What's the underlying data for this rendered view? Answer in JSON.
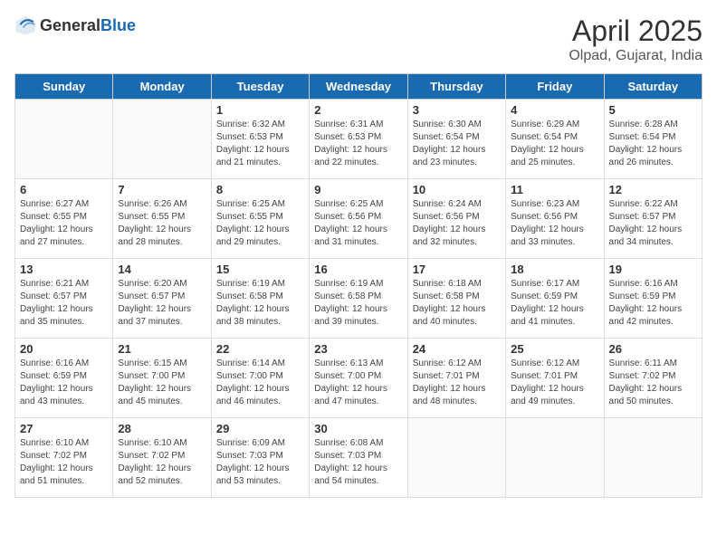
{
  "header": {
    "logo_general": "General",
    "logo_blue": "Blue",
    "month_title": "April 2025",
    "location": "Olpad, Gujarat, India"
  },
  "days_of_week": [
    "Sunday",
    "Monday",
    "Tuesday",
    "Wednesday",
    "Thursday",
    "Friday",
    "Saturday"
  ],
  "weeks": [
    [
      {
        "day": "",
        "info": ""
      },
      {
        "day": "",
        "info": ""
      },
      {
        "day": "1",
        "info": "Sunrise: 6:32 AM\nSunset: 6:53 PM\nDaylight: 12 hours and 21 minutes."
      },
      {
        "day": "2",
        "info": "Sunrise: 6:31 AM\nSunset: 6:53 PM\nDaylight: 12 hours and 22 minutes."
      },
      {
        "day": "3",
        "info": "Sunrise: 6:30 AM\nSunset: 6:54 PM\nDaylight: 12 hours and 23 minutes."
      },
      {
        "day": "4",
        "info": "Sunrise: 6:29 AM\nSunset: 6:54 PM\nDaylight: 12 hours and 25 minutes."
      },
      {
        "day": "5",
        "info": "Sunrise: 6:28 AM\nSunset: 6:54 PM\nDaylight: 12 hours and 26 minutes."
      }
    ],
    [
      {
        "day": "6",
        "info": "Sunrise: 6:27 AM\nSunset: 6:55 PM\nDaylight: 12 hours and 27 minutes."
      },
      {
        "day": "7",
        "info": "Sunrise: 6:26 AM\nSunset: 6:55 PM\nDaylight: 12 hours and 28 minutes."
      },
      {
        "day": "8",
        "info": "Sunrise: 6:25 AM\nSunset: 6:55 PM\nDaylight: 12 hours and 29 minutes."
      },
      {
        "day": "9",
        "info": "Sunrise: 6:25 AM\nSunset: 6:56 PM\nDaylight: 12 hours and 31 minutes."
      },
      {
        "day": "10",
        "info": "Sunrise: 6:24 AM\nSunset: 6:56 PM\nDaylight: 12 hours and 32 minutes."
      },
      {
        "day": "11",
        "info": "Sunrise: 6:23 AM\nSunset: 6:56 PM\nDaylight: 12 hours and 33 minutes."
      },
      {
        "day": "12",
        "info": "Sunrise: 6:22 AM\nSunset: 6:57 PM\nDaylight: 12 hours and 34 minutes."
      }
    ],
    [
      {
        "day": "13",
        "info": "Sunrise: 6:21 AM\nSunset: 6:57 PM\nDaylight: 12 hours and 35 minutes."
      },
      {
        "day": "14",
        "info": "Sunrise: 6:20 AM\nSunset: 6:57 PM\nDaylight: 12 hours and 37 minutes."
      },
      {
        "day": "15",
        "info": "Sunrise: 6:19 AM\nSunset: 6:58 PM\nDaylight: 12 hours and 38 minutes."
      },
      {
        "day": "16",
        "info": "Sunrise: 6:19 AM\nSunset: 6:58 PM\nDaylight: 12 hours and 39 minutes."
      },
      {
        "day": "17",
        "info": "Sunrise: 6:18 AM\nSunset: 6:58 PM\nDaylight: 12 hours and 40 minutes."
      },
      {
        "day": "18",
        "info": "Sunrise: 6:17 AM\nSunset: 6:59 PM\nDaylight: 12 hours and 41 minutes."
      },
      {
        "day": "19",
        "info": "Sunrise: 6:16 AM\nSunset: 6:59 PM\nDaylight: 12 hours and 42 minutes."
      }
    ],
    [
      {
        "day": "20",
        "info": "Sunrise: 6:16 AM\nSunset: 6:59 PM\nDaylight: 12 hours and 43 minutes."
      },
      {
        "day": "21",
        "info": "Sunrise: 6:15 AM\nSunset: 7:00 PM\nDaylight: 12 hours and 45 minutes."
      },
      {
        "day": "22",
        "info": "Sunrise: 6:14 AM\nSunset: 7:00 PM\nDaylight: 12 hours and 46 minutes."
      },
      {
        "day": "23",
        "info": "Sunrise: 6:13 AM\nSunset: 7:00 PM\nDaylight: 12 hours and 47 minutes."
      },
      {
        "day": "24",
        "info": "Sunrise: 6:12 AM\nSunset: 7:01 PM\nDaylight: 12 hours and 48 minutes."
      },
      {
        "day": "25",
        "info": "Sunrise: 6:12 AM\nSunset: 7:01 PM\nDaylight: 12 hours and 49 minutes."
      },
      {
        "day": "26",
        "info": "Sunrise: 6:11 AM\nSunset: 7:02 PM\nDaylight: 12 hours and 50 minutes."
      }
    ],
    [
      {
        "day": "27",
        "info": "Sunrise: 6:10 AM\nSunset: 7:02 PM\nDaylight: 12 hours and 51 minutes."
      },
      {
        "day": "28",
        "info": "Sunrise: 6:10 AM\nSunset: 7:02 PM\nDaylight: 12 hours and 52 minutes."
      },
      {
        "day": "29",
        "info": "Sunrise: 6:09 AM\nSunset: 7:03 PM\nDaylight: 12 hours and 53 minutes."
      },
      {
        "day": "30",
        "info": "Sunrise: 6:08 AM\nSunset: 7:03 PM\nDaylight: 12 hours and 54 minutes."
      },
      {
        "day": "",
        "info": ""
      },
      {
        "day": "",
        "info": ""
      },
      {
        "day": "",
        "info": ""
      }
    ]
  ]
}
